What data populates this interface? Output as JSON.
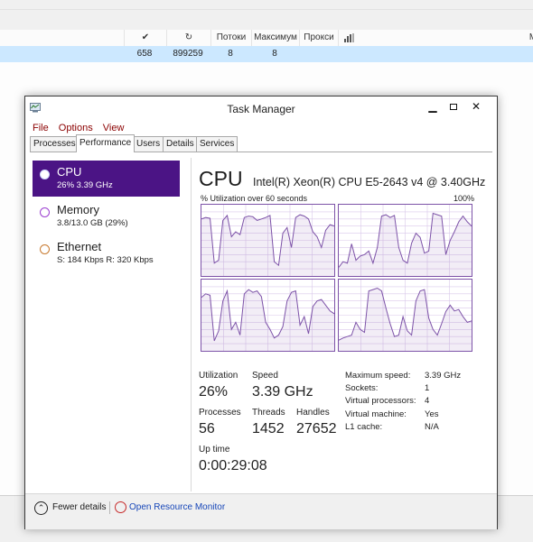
{
  "background_window": {
    "headers": [
      "✔",
      "↻",
      "Потоки",
      "Максимум",
      "Прокси",
      "",
      "М"
    ],
    "row": [
      "658",
      "899259",
      "8",
      "8"
    ]
  },
  "window": {
    "title": "Task Manager"
  },
  "menu": [
    "File",
    "Options",
    "View"
  ],
  "tabs": [
    "Processes",
    "Performance",
    "Users",
    "Details",
    "Services"
  ],
  "resources": [
    {
      "name": "CPU",
      "detail": "26% 3.39 GHz",
      "selected": true,
      "color": "#4b1485"
    },
    {
      "name": "Memory",
      "detail": "3.8/13.0 GB (29%)",
      "color": "#8b28c5"
    },
    {
      "name": "Ethernet",
      "detail": "S: 184 Kbps R: 320 Kbps",
      "color": "#c87a2f"
    }
  ],
  "cpu": {
    "title": "CPU",
    "model": "Intel(R) Xeon(R) CPU E5-2643 v4 @ 3.40GHz",
    "graph_label": "% Utilization over 60 seconds",
    "graph_max": "100%",
    "stats": {
      "utilization_label": "Utilization",
      "utilization": "26%",
      "speed_label": "Speed",
      "speed": "3.39 GHz",
      "processes_label": "Processes",
      "processes": "56",
      "threads_label": "Threads",
      "threads": "1452",
      "handles_label": "Handles",
      "handles": "27652",
      "uptime_label": "Up time",
      "uptime": "0:00:29:08"
    },
    "specs": [
      {
        "key": "Maximum speed:",
        "value": "3.39 GHz"
      },
      {
        "key": "Sockets:",
        "value": "1"
      },
      {
        "key": "Virtual processors:",
        "value": "4"
      },
      {
        "key": "Virtual machine:",
        "value": "Yes"
      },
      {
        "key": "L1 cache:",
        "value": "N/A"
      }
    ],
    "core_series": [
      [
        80,
        82,
        81,
        18,
        22,
        78,
        85,
        55,
        62,
        58,
        82,
        84,
        83,
        78,
        80,
        82,
        85,
        20,
        15,
        60,
        68,
        40,
        82,
        86,
        84,
        80,
        62,
        55,
        40,
        64,
        72,
        70
      ],
      [
        12,
        20,
        18,
        45,
        22,
        28,
        30,
        35,
        18,
        40,
        84,
        86,
        82,
        85,
        40,
        22,
        18,
        46,
        60,
        54,
        32,
        35,
        88,
        86,
        84,
        30,
        50,
        62,
        76,
        84,
        76,
        70
      ],
      [
        75,
        80,
        78,
        14,
        28,
        70,
        84,
        30,
        40,
        22,
        80,
        86,
        82,
        84,
        76,
        40,
        30,
        18,
        22,
        34,
        70,
        82,
        84,
        36,
        48,
        24,
        62,
        70,
        72,
        64,
        56,
        52
      ],
      [
        15,
        18,
        20,
        22,
        40,
        30,
        26,
        84,
        86,
        88,
        84,
        60,
        38,
        20,
        22,
        48,
        28,
        22,
        70,
        84,
        86,
        46,
        30,
        22,
        38,
        55,
        64,
        56,
        58,
        48,
        40,
        42
      ]
    ],
    "graph_color": "#7d53a8"
  },
  "footer": {
    "fewer_details": "Fewer details",
    "open_monitor": "Open Resource Monitor"
  }
}
